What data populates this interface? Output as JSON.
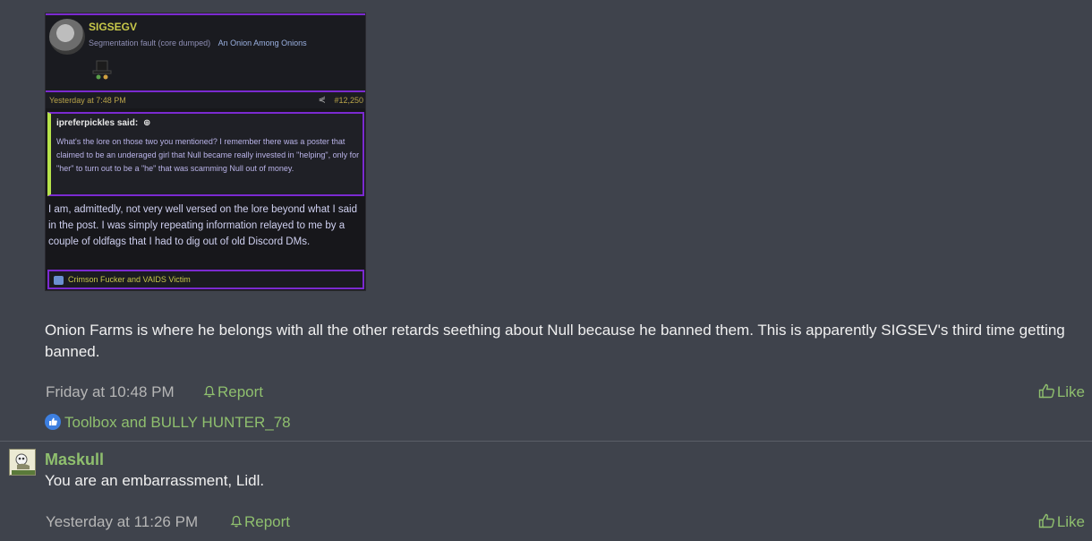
{
  "post1": {
    "embed": {
      "name": "SIGSEGV",
      "subtitle": "Segmentation fault (core dumped)",
      "title2": "An Onion Among Onions",
      "date": "Yesterday at 7:48 PM",
      "post_number": "#12,250",
      "quote_author": "ipreferpickles said:",
      "quote_text": "What's the lore on those two you mentioned? I remember there was a poster that claimed to be an underaged girl that Null became really invested in \"helping\", only for \"her\" to turn out to be a \"he\" that was scamming Null out of money.",
      "body": "I am, admittedly, not very well versed on the lore beyond what I said in the post. I was simply repeating information relayed to me by a couple of oldfags that I had to dig out of old Discord DMs.",
      "signature": "Crimson Fucker and VAIDS Victim"
    },
    "text": "Onion Farms is where he belongs with all the other retards seething about Null because he banned them. This is apparently SIGSEV's third time getting banned.",
    "date": "Friday at 10:48 PM",
    "report_label": "Report",
    "like_label": "Like",
    "reactions_text": "Toolbox and BULLY HUNTER_78"
  },
  "post2": {
    "username": "Maskull",
    "text": "You are an embarrassment, Lidl.",
    "date": "Yesterday at 11:26 PM",
    "report_label": "Report",
    "like_label": "Like"
  },
  "colors": {
    "background": "#3f434c",
    "link_green": "#8fbf6e",
    "embed_purple": "#7b2ad0",
    "embed_name": "#c9c94a"
  }
}
